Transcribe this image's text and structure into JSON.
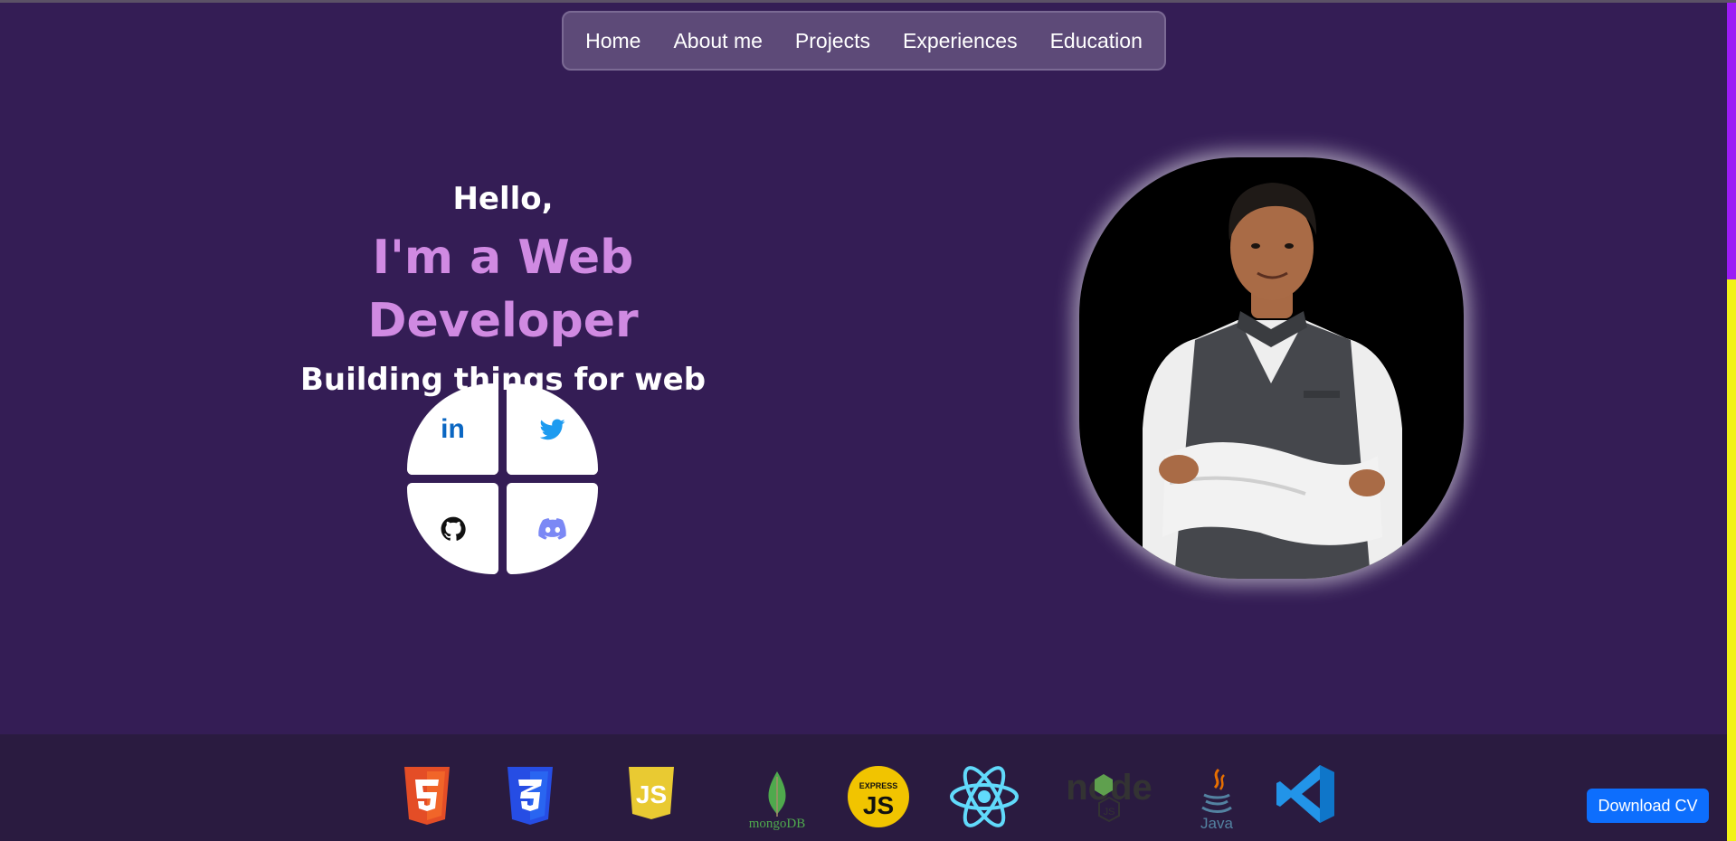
{
  "nav": {
    "items": [
      {
        "label": "Home"
      },
      {
        "label": "About me"
      },
      {
        "label": "Projects"
      },
      {
        "label": "Experiences"
      },
      {
        "label": "Education"
      }
    ]
  },
  "hero": {
    "greeting": "Hello,",
    "role": "I'm a Web Developer",
    "tagline": "Building things for web"
  },
  "social": {
    "linkedin_text": "in",
    "icons": [
      "linkedin-icon",
      "twitter-icon",
      "github-icon",
      "discord-icon"
    ]
  },
  "tech": {
    "mongodb_label": "mongoDB",
    "express_top": "EXPRESS",
    "express_main": "JS",
    "java_label": "Java",
    "icons": [
      "html5-icon",
      "css3-icon",
      "javascript-icon",
      "mongodb-icon",
      "express-icon",
      "react-icon",
      "nodejs-icon",
      "java-icon",
      "vscode-icon"
    ]
  },
  "actions": {
    "download_cv": "Download CV"
  },
  "colors": {
    "background": "#341d55",
    "accent": "#d08ae2",
    "nav_bg": "#5d4a78",
    "strip_bg": "#2a1b40",
    "button": "#0d6efd",
    "scroll_track": "#f2f217",
    "scroll_thumb": "#9c1bf5"
  }
}
